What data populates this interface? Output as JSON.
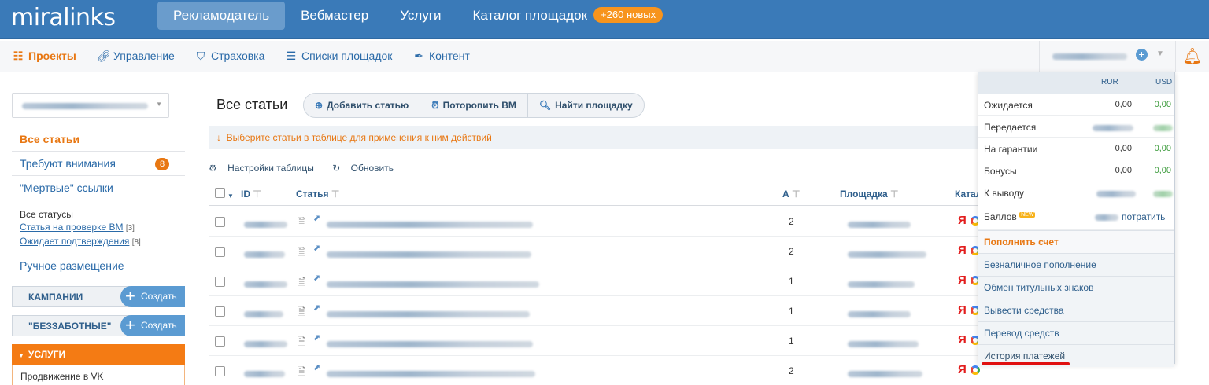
{
  "logo": "miralinks",
  "top_nav": [
    {
      "label": "Рекламодатель"
    },
    {
      "label": "Вебмастер"
    },
    {
      "label": "Услуги"
    },
    {
      "label": "Каталог площадок"
    }
  ],
  "top_nav_badge": "+260 новых",
  "sub_nav": [
    {
      "label": "Проекты",
      "icon": "list-icon"
    },
    {
      "label": "Управление",
      "icon": "link-icon"
    },
    {
      "label": "Страховка",
      "icon": "shield-icon"
    },
    {
      "label": "Списки площадок",
      "icon": "list-bullets-icon"
    },
    {
      "label": "Контент",
      "icon": "pen-icon"
    }
  ],
  "sidebar": {
    "items": [
      {
        "label": "Все статьи"
      },
      {
        "label": "Требуют внимания",
        "count": "8"
      },
      {
        "label": "\"Мертвые\" ссылки"
      }
    ],
    "statuses_title": "Все статусы",
    "status_links": [
      {
        "label": "Статья на проверке ВМ",
        "count": "[3]"
      },
      {
        "label": "Ожидает подтверждения",
        "count": "[8]"
      }
    ],
    "manual": "Ручное размещение",
    "campaigns_label": "КАМПАНИИ",
    "carefree_label": "\"БЕЗЗАБОТНЫЕ\"",
    "create_label": "Создать",
    "services_label": "УСЛУГИ",
    "services_item": "Продвижение в VK"
  },
  "main": {
    "title": "Все статьи",
    "buttons": [
      {
        "label": "Добавить статью",
        "icon": "plus-circle-icon"
      },
      {
        "label": "Поторопить ВМ",
        "icon": "alarm-clock-icon"
      },
      {
        "label": "Найти площадку",
        "icon": "search-icon"
      }
    ],
    "hint": "Выберите статьи в таблице для применения к ним действий",
    "hint_arrow": "↓",
    "table_settings": "Настройки таблицы",
    "refresh": "Обновить",
    "columns": {
      "id": "ID",
      "article": "Статья",
      "a": "А",
      "site": "Площадка",
      "catalog": "Катал"
    },
    "rows": [
      {
        "a": "2"
      },
      {
        "a": "2"
      },
      {
        "a": "1"
      },
      {
        "a": "1"
      },
      {
        "a": "1"
      },
      {
        "a": "2"
      }
    ]
  },
  "balance": {
    "currencies": [
      "RUR",
      "USD"
    ],
    "rows": [
      {
        "label": "Ожидается",
        "rur": "0,00",
        "usd": "0,00"
      },
      {
        "label": "Передается"
      },
      {
        "label": "На гарантии",
        "rur": "0,00",
        "usd": "0,00"
      },
      {
        "label": "Бонусы",
        "rur": "0,00",
        "usd": "0,00"
      },
      {
        "label": "К выводу"
      }
    ],
    "points_label": "Баллов",
    "points_new": "NEW",
    "spend_label": "потратить",
    "links": [
      "Пополнить счет",
      "Безналичное пополнение",
      "Обмен титульных знаков",
      "Вывести средства",
      "Перевод средств",
      "История платежей"
    ]
  }
}
